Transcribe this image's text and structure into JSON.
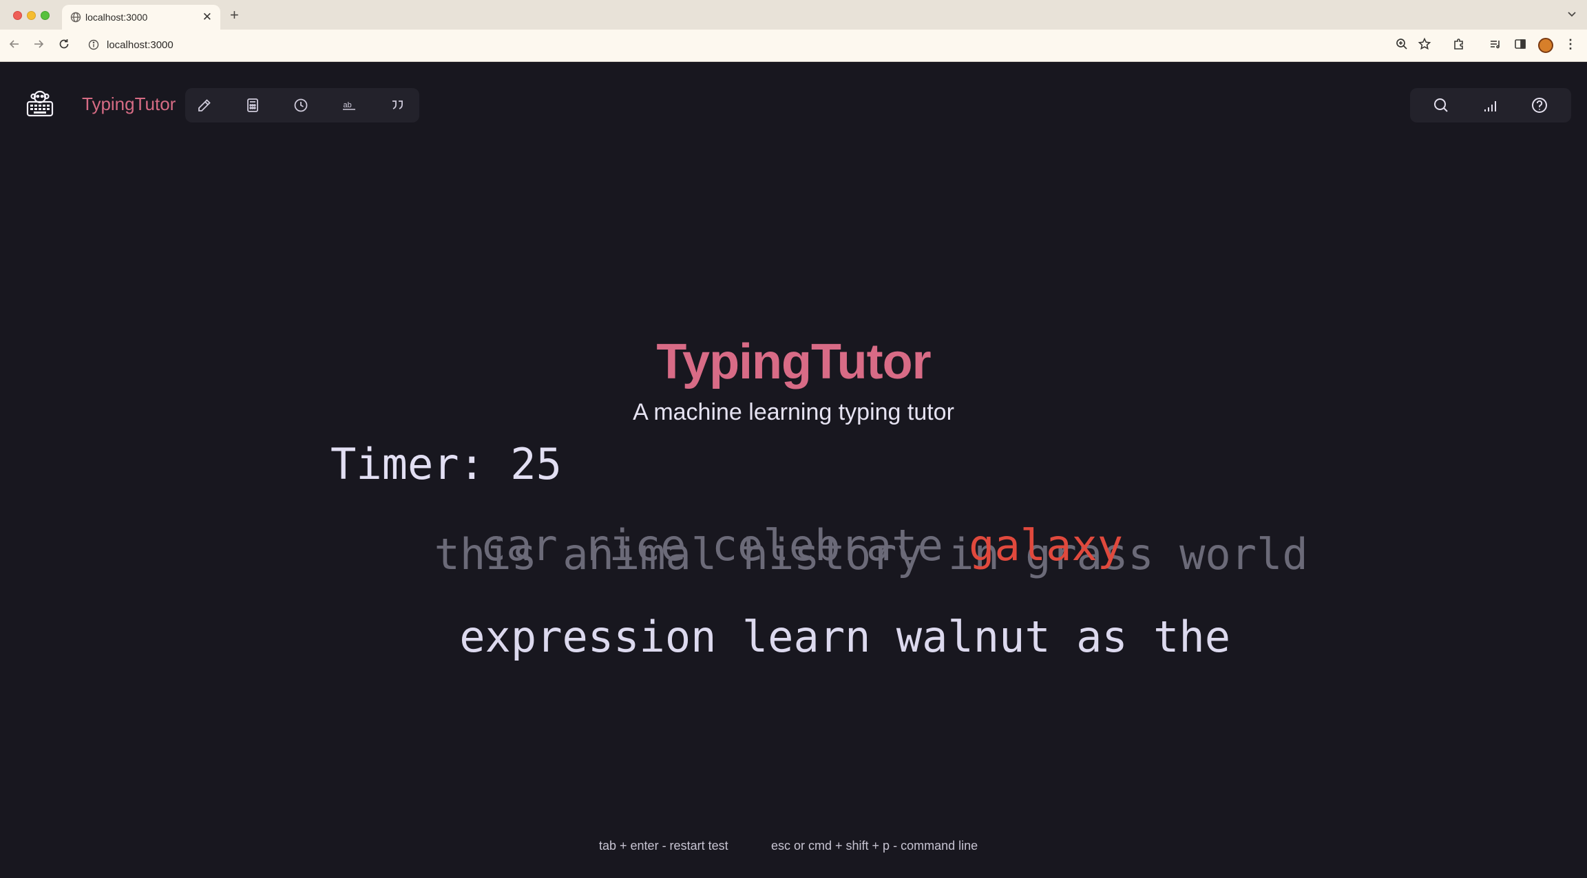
{
  "browser": {
    "tab_title": "localhost:3000",
    "url": "localhost:3000",
    "new_tab": "+",
    "tab_close": "✕",
    "menu": "⋮"
  },
  "app": {
    "brand": "TypingTutor",
    "toolbar_icons": [
      "pencil-icon",
      "calculator-icon",
      "clock-icon",
      "ab-text-icon",
      "quote-icon"
    ],
    "right_icons": [
      "search-icon",
      "signal-bars-icon",
      "help-icon"
    ],
    "accent_color": "#d86b86",
    "error_color": "#e0493d"
  },
  "hero": {
    "title": "TypingTutor",
    "subtitle": "A machine learning typing tutor"
  },
  "test": {
    "timer": "Timer: 25",
    "line1": "this animal history in grass world",
    "line2_typed": "car rice celebrate ",
    "line2_current": "galaxy",
    "line3": "expression learn walnut as the"
  },
  "footer": {
    "hint_restart": "tab + enter - restart test",
    "hint_command": "esc or cmd + shift + p - command line"
  }
}
